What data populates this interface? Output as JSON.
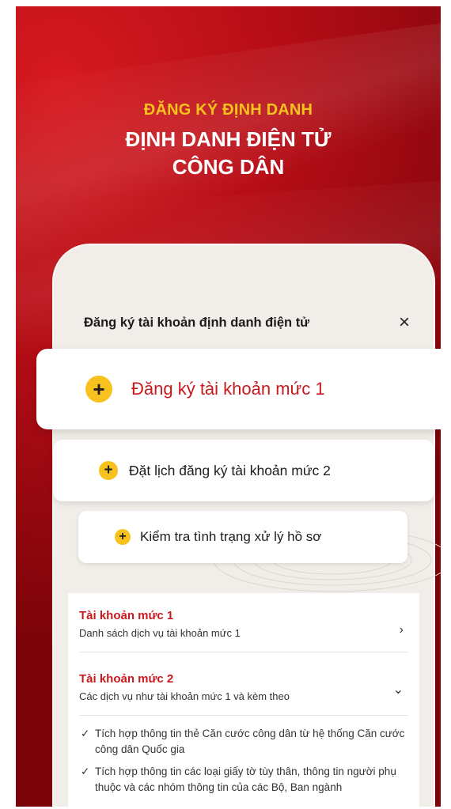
{
  "hero": {
    "supertitle": "ĐĂNG KÝ ĐỊNH DANH",
    "title_line1": "ĐỊNH DANH ĐIỆN TỬ",
    "title_line2": "CÔNG DÂN"
  },
  "dialog": {
    "title": "Đăng ký tài khoản định danh điện tử",
    "close_glyph": "×"
  },
  "actions": [
    {
      "label": "Đăng ký tài khoản mức 1",
      "icon": "plus-icon"
    },
    {
      "label": "Đặt lịch đăng ký tài khoản mức 2",
      "icon": "plus-icon"
    },
    {
      "label": "Kiểm tra tình trạng xử lý hồ sơ",
      "icon": "plus-icon"
    }
  ],
  "levels": [
    {
      "title": "Tài khoản mức 1",
      "subtitle": "Danh sách dịch vụ tài khoản mức 1",
      "chevron": "›"
    },
    {
      "title": "Tài khoản mức 2",
      "subtitle": "Các dịch vụ như tài khoản mức 1 và kèm theo",
      "chevron": "⌄"
    }
  ],
  "level2_features": [
    "Tích hợp thông tin thẻ Căn cước công dân từ hệ thống Căn cước công dân Quốc gia",
    "Tích hợp thông tin các loại giấy tờ tùy thân, thông tin người phụ thuộc và các nhóm thông tin của các Bộ, Ban ngành"
  ],
  "colors": {
    "brand_red": "#c8191e",
    "accent_yellow": "#f7c21e",
    "gold_text": "#f6c21c"
  }
}
